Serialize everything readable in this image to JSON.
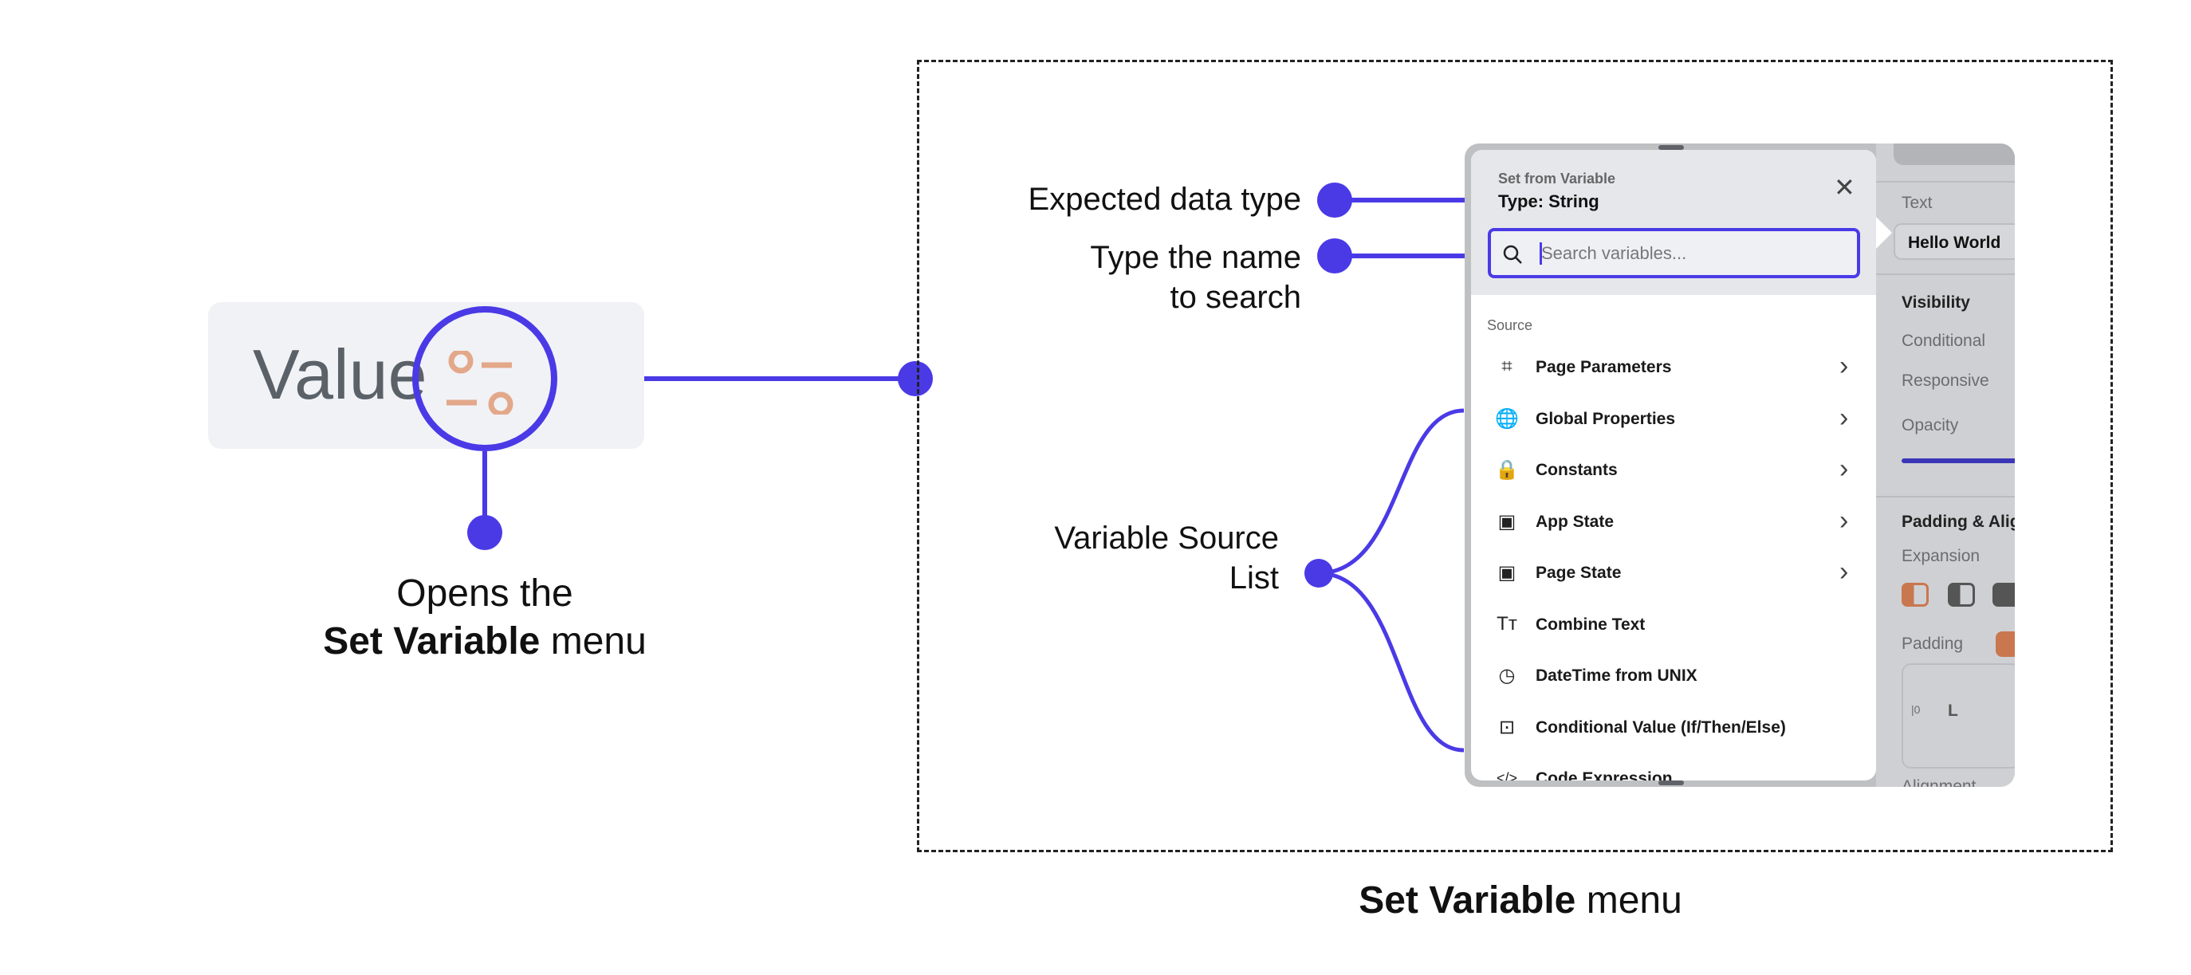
{
  "left": {
    "value_label": "Value",
    "caption_line1": "Opens the",
    "caption_bold": "Set Variable",
    "caption_rest": " menu"
  },
  "annotations": {
    "expected_type": "Expected data type",
    "search_line1": "Type the name",
    "search_line2": "to search",
    "source_line1": "Variable Source",
    "source_line2": "List"
  },
  "caption": {
    "bold": "Set Variable",
    "rest": " menu"
  },
  "popup": {
    "title": "Set from Variable",
    "type": "Type: String",
    "search_placeholder": "Search variables...",
    "section": "Source",
    "items": [
      {
        "label": "Page Parameters",
        "icon": "page-parameters-icon",
        "chevron": true
      },
      {
        "label": "Global Properties",
        "icon": "globe-icon",
        "chevron": true
      },
      {
        "label": "Constants",
        "icon": "lock-icon",
        "chevron": true
      },
      {
        "label": "App State",
        "icon": "folder-icon",
        "chevron": true
      },
      {
        "label": "Page State",
        "icon": "folder-icon",
        "chevron": true
      },
      {
        "label": "Combine Text",
        "icon": "text-icon",
        "chevron": false
      },
      {
        "label": "DateTime from UNIX",
        "icon": "clock-icon",
        "chevron": false
      },
      {
        "label": "Conditional Value (If/Then/Else)",
        "icon": "conditional-icon",
        "chevron": false
      },
      {
        "label": "Code Expression",
        "icon": "code-icon",
        "chevron": false
      }
    ]
  },
  "side": {
    "text_label": "Text",
    "text_value": "Hello World",
    "visibility": "Visibility",
    "conditional": "Conditional",
    "responsive": "Responsive",
    "opacity": "Opacity",
    "padding_align": "Padding & Alig",
    "expansion": "Expansion",
    "padding": "Padding",
    "padding_left": "L",
    "alignment": "Alignment"
  },
  "colors": {
    "accent": "#4a3ae6",
    "variable_icon": "#e3a88a"
  }
}
